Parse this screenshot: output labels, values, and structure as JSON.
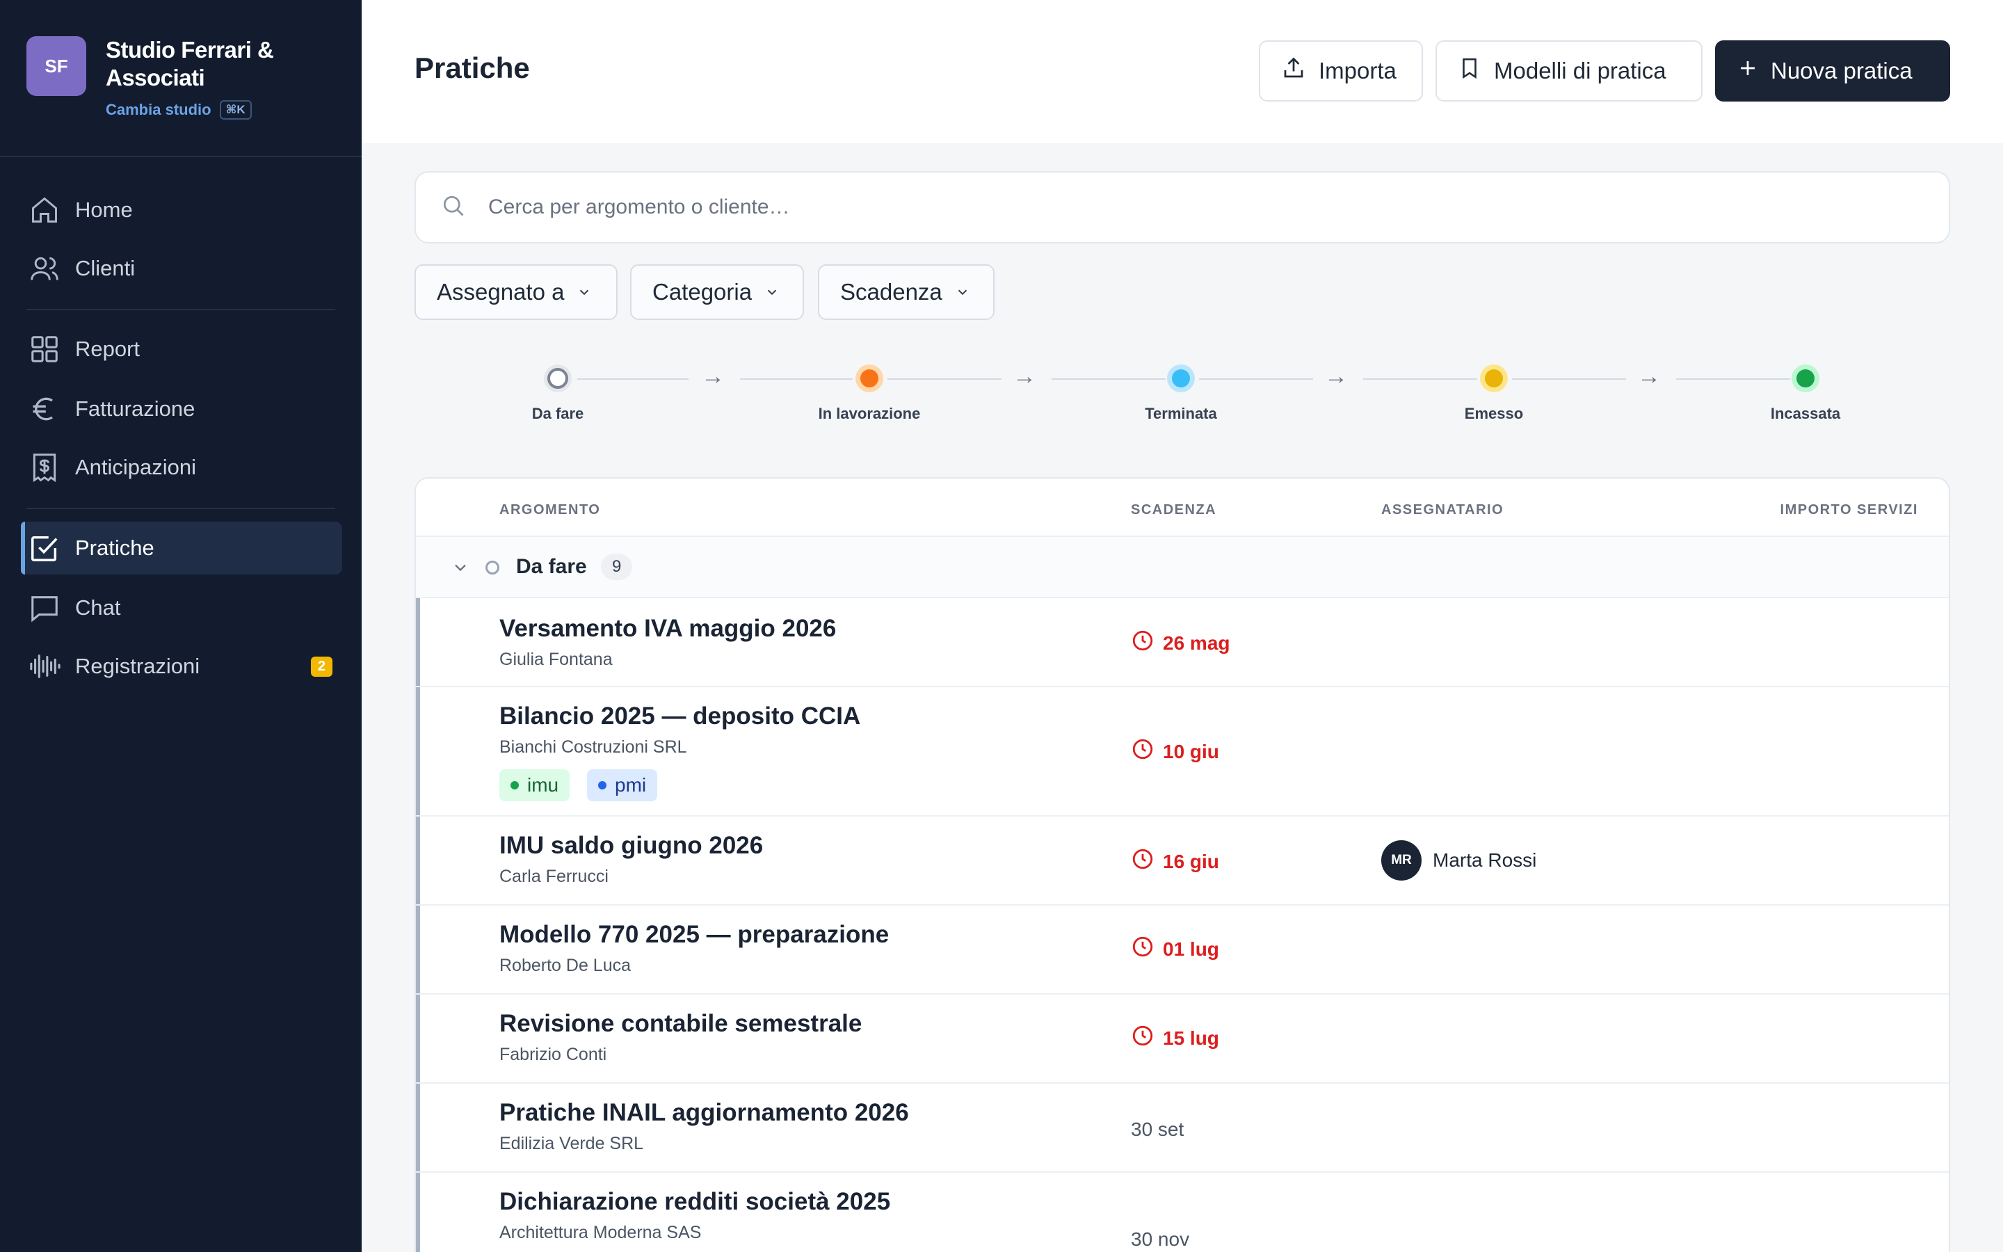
{
  "studio": {
    "initials": "SF",
    "name": "Studio Ferrari & Associati",
    "switch_label": "Cambia studio",
    "shortcut": "⌘K"
  },
  "sidebar": {
    "items": [
      {
        "label": "Home",
        "icon": "home-icon"
      },
      {
        "label": "Clienti",
        "icon": "users-icon"
      },
      {
        "label": "Report",
        "icon": "grid-icon"
      },
      {
        "label": "Fatturazione",
        "icon": "euro-icon"
      },
      {
        "label": "Anticipazioni",
        "icon": "receipt-icon"
      },
      {
        "label": "Pratiche",
        "icon": "check-square-icon",
        "active": true
      },
      {
        "label": "Chat",
        "icon": "chat-icon"
      },
      {
        "label": "Registrazioni",
        "icon": "waveform-icon",
        "badge": "2"
      }
    ]
  },
  "header": {
    "title": "Pratiche",
    "import_label": "Importa",
    "templates_label": "Modelli di pratica",
    "new_label": "Nuova pratica"
  },
  "search": {
    "placeholder": "Cerca per argomento o cliente…"
  },
  "filters": [
    {
      "label": "Assegnato a"
    },
    {
      "label": "Categoria"
    },
    {
      "label": "Scadenza"
    }
  ],
  "pipeline": [
    {
      "label": "Da fare",
      "color": "#ffffff"
    },
    {
      "label": "In lavorazione",
      "color": "#f97316"
    },
    {
      "label": "Terminata",
      "color": "#38bdf8"
    },
    {
      "label": "Emesso",
      "color": "#eab308"
    },
    {
      "label": "Incassata",
      "color": "#16a34a"
    }
  ],
  "table": {
    "columns": {
      "topic": "ARGOMENTO",
      "due": "SCADENZA",
      "assignee": "ASSEGNATARIO",
      "amount": "IMPORTO SERVIZI"
    },
    "group": {
      "label": "Da fare",
      "count": "9"
    },
    "rows": [
      {
        "title": "Versamento IVA maggio 2026",
        "client": "Giulia Fontana",
        "due": "26 mag",
        "overdue": true
      },
      {
        "title": "Bilancio 2025 — deposito CCIA",
        "client": "Bianchi Costruzioni SRL",
        "due": "10 giu",
        "overdue": true,
        "tags": [
          {
            "label": "imu",
            "color": "#16a34a"
          },
          {
            "label": "pmi",
            "color": "#2563eb"
          }
        ]
      },
      {
        "title": "IMU saldo giugno 2026",
        "client": "Carla Ferrucci",
        "due": "16 giu",
        "overdue": true,
        "assignee": {
          "initials": "MR",
          "name": "Marta Rossi"
        }
      },
      {
        "title": "Modello 770 2025 — preparazione",
        "client": "Roberto De Luca",
        "due": "01 lug",
        "overdue": true
      },
      {
        "title": "Revisione contabile semestrale",
        "client": "Fabrizio Conti",
        "due": "15 lug",
        "overdue": true
      },
      {
        "title": "Pratiche INAIL aggiornamento 2026",
        "client": "Edilizia Verde SRL",
        "due": "30 set",
        "overdue": false
      },
      {
        "title": "Dichiarazione redditi società 2025",
        "client": "Architettura Moderna SAS",
        "due": "30 nov",
        "overdue": false
      }
    ]
  }
}
